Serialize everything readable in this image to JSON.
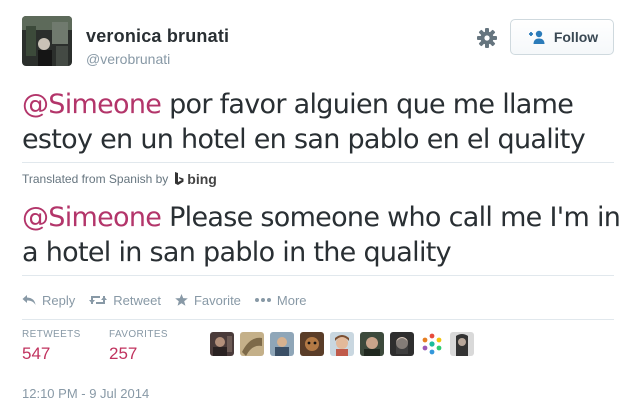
{
  "user": {
    "display_name": "veronica brunati",
    "handle": "@verobrunati"
  },
  "follow_label": "Follow",
  "tweet": {
    "original": {
      "mention": "@Simeone",
      "text": " por favor alguien que me llame estoy en un hotel en san pablo en el quality"
    },
    "translation_note": "Translated from Spanish by",
    "translation_provider": "bing",
    "translated": {
      "mention": "@Simeone",
      "text": " Please someone who call me I'm in a hotel in san pablo in the quality"
    }
  },
  "actions": [
    {
      "label": "Reply",
      "icon": "reply-icon"
    },
    {
      "label": "Retweet",
      "icon": "retweet-icon"
    },
    {
      "label": "Favorite",
      "icon": "star-icon"
    },
    {
      "label": "More",
      "icon": "more-icon"
    }
  ],
  "stats": {
    "retweets_label": "RETWEETS",
    "retweets_count": "547",
    "favorites_label": "FAVORITES",
    "favorites_count": "257"
  },
  "timestamp": "12:10 PM - 9 Jul 2014",
  "colors": {
    "mention": "#b3356a",
    "count": "#c0325e",
    "muted": "#8899a6"
  }
}
